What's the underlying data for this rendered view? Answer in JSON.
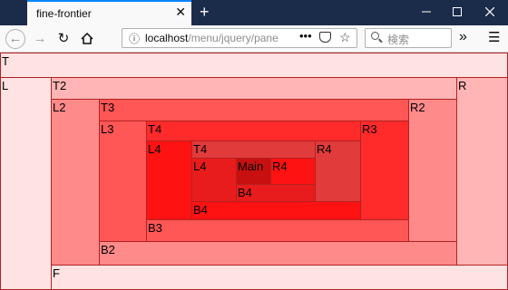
{
  "browser": {
    "tab_title": "fine-frontier",
    "tab_close": "✕",
    "new_tab": "+",
    "url_host": "localhost",
    "url_path": "/menu/jquery/pane",
    "url_more": "•••",
    "search_placeholder": "検索",
    "icons": [
      "back-icon",
      "forward-icon",
      "reload-icon",
      "home-icon",
      "info-icon",
      "pocket-icon",
      "star-icon",
      "search-icon",
      "overflow-icon",
      "menu-icon",
      "minimize-icon",
      "maximize-icon",
      "close-icon"
    ]
  },
  "layout": {
    "outer": {
      "top": "T",
      "left": "L",
      "right": "R",
      "bottom": "F"
    },
    "ring1": {
      "top": "T2",
      "left": "L2",
      "right": "R2",
      "bottom": "B2"
    },
    "ring2": {
      "top": "T3",
      "left": "L3",
      "right": "R3",
      "bottom": "B3"
    },
    "ring3": {
      "top": "T4",
      "left": "L4",
      "right": "R4",
      "bottom": "B4"
    },
    "ring4": {
      "top": "T4",
      "left": "L4",
      "right": "R4",
      "bottom": "B4"
    },
    "inner": {
      "main": "Main",
      "right": "R4",
      "bottom": "B4"
    }
  },
  "colors": {
    "outer": "#ffe2e2",
    "level1": "#ffb5b5",
    "level2": "#ff8a8a",
    "level3": "#ff5656",
    "level4": "#ff2a2a",
    "level4_alt": "#e81c1c",
    "level5": "#ff1212",
    "level5_alt": "#e13b3b",
    "main": "#c81010",
    "border": "#b22222"
  }
}
